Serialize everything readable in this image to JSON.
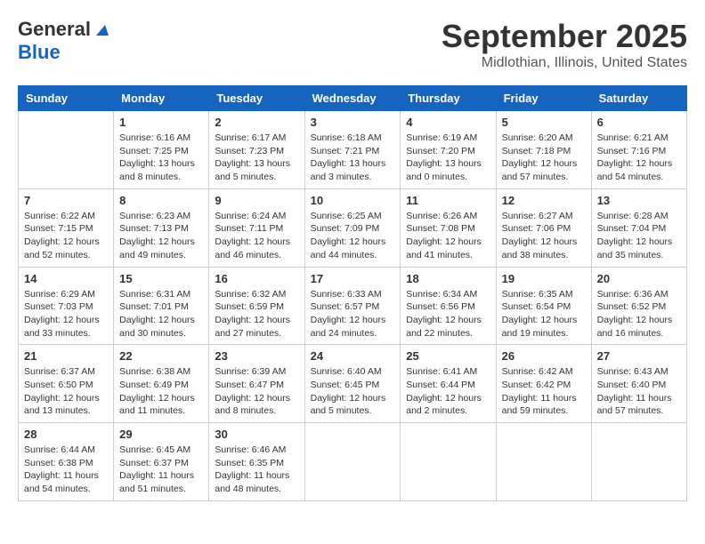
{
  "header": {
    "logo_line1": "General",
    "logo_line2": "Blue",
    "month_title": "September 2025",
    "location": "Midlothian, Illinois, United States"
  },
  "weekdays": [
    "Sunday",
    "Monday",
    "Tuesday",
    "Wednesday",
    "Thursday",
    "Friday",
    "Saturday"
  ],
  "weeks": [
    [
      {
        "day": "",
        "info": ""
      },
      {
        "day": "1",
        "info": "Sunrise: 6:16 AM\nSunset: 7:25 PM\nDaylight: 13 hours\nand 8 minutes."
      },
      {
        "day": "2",
        "info": "Sunrise: 6:17 AM\nSunset: 7:23 PM\nDaylight: 13 hours\nand 5 minutes."
      },
      {
        "day": "3",
        "info": "Sunrise: 6:18 AM\nSunset: 7:21 PM\nDaylight: 13 hours\nand 3 minutes."
      },
      {
        "day": "4",
        "info": "Sunrise: 6:19 AM\nSunset: 7:20 PM\nDaylight: 13 hours\nand 0 minutes."
      },
      {
        "day": "5",
        "info": "Sunrise: 6:20 AM\nSunset: 7:18 PM\nDaylight: 12 hours\nand 57 minutes."
      },
      {
        "day": "6",
        "info": "Sunrise: 6:21 AM\nSunset: 7:16 PM\nDaylight: 12 hours\nand 54 minutes."
      }
    ],
    [
      {
        "day": "7",
        "info": "Sunrise: 6:22 AM\nSunset: 7:15 PM\nDaylight: 12 hours\nand 52 minutes."
      },
      {
        "day": "8",
        "info": "Sunrise: 6:23 AM\nSunset: 7:13 PM\nDaylight: 12 hours\nand 49 minutes."
      },
      {
        "day": "9",
        "info": "Sunrise: 6:24 AM\nSunset: 7:11 PM\nDaylight: 12 hours\nand 46 minutes."
      },
      {
        "day": "10",
        "info": "Sunrise: 6:25 AM\nSunset: 7:09 PM\nDaylight: 12 hours\nand 44 minutes."
      },
      {
        "day": "11",
        "info": "Sunrise: 6:26 AM\nSunset: 7:08 PM\nDaylight: 12 hours\nand 41 minutes."
      },
      {
        "day": "12",
        "info": "Sunrise: 6:27 AM\nSunset: 7:06 PM\nDaylight: 12 hours\nand 38 minutes."
      },
      {
        "day": "13",
        "info": "Sunrise: 6:28 AM\nSunset: 7:04 PM\nDaylight: 12 hours\nand 35 minutes."
      }
    ],
    [
      {
        "day": "14",
        "info": "Sunrise: 6:29 AM\nSunset: 7:03 PM\nDaylight: 12 hours\nand 33 minutes."
      },
      {
        "day": "15",
        "info": "Sunrise: 6:31 AM\nSunset: 7:01 PM\nDaylight: 12 hours\nand 30 minutes."
      },
      {
        "day": "16",
        "info": "Sunrise: 6:32 AM\nSunset: 6:59 PM\nDaylight: 12 hours\nand 27 minutes."
      },
      {
        "day": "17",
        "info": "Sunrise: 6:33 AM\nSunset: 6:57 PM\nDaylight: 12 hours\nand 24 minutes."
      },
      {
        "day": "18",
        "info": "Sunrise: 6:34 AM\nSunset: 6:56 PM\nDaylight: 12 hours\nand 22 minutes."
      },
      {
        "day": "19",
        "info": "Sunrise: 6:35 AM\nSunset: 6:54 PM\nDaylight: 12 hours\nand 19 minutes."
      },
      {
        "day": "20",
        "info": "Sunrise: 6:36 AM\nSunset: 6:52 PM\nDaylight: 12 hours\nand 16 minutes."
      }
    ],
    [
      {
        "day": "21",
        "info": "Sunrise: 6:37 AM\nSunset: 6:50 PM\nDaylight: 12 hours\nand 13 minutes."
      },
      {
        "day": "22",
        "info": "Sunrise: 6:38 AM\nSunset: 6:49 PM\nDaylight: 12 hours\nand 11 minutes."
      },
      {
        "day": "23",
        "info": "Sunrise: 6:39 AM\nSunset: 6:47 PM\nDaylight: 12 hours\nand 8 minutes."
      },
      {
        "day": "24",
        "info": "Sunrise: 6:40 AM\nSunset: 6:45 PM\nDaylight: 12 hours\nand 5 minutes."
      },
      {
        "day": "25",
        "info": "Sunrise: 6:41 AM\nSunset: 6:44 PM\nDaylight: 12 hours\nand 2 minutes."
      },
      {
        "day": "26",
        "info": "Sunrise: 6:42 AM\nSunset: 6:42 PM\nDaylight: 11 hours\nand 59 minutes."
      },
      {
        "day": "27",
        "info": "Sunrise: 6:43 AM\nSunset: 6:40 PM\nDaylight: 11 hours\nand 57 minutes."
      }
    ],
    [
      {
        "day": "28",
        "info": "Sunrise: 6:44 AM\nSunset: 6:38 PM\nDaylight: 11 hours\nand 54 minutes."
      },
      {
        "day": "29",
        "info": "Sunrise: 6:45 AM\nSunset: 6:37 PM\nDaylight: 11 hours\nand 51 minutes."
      },
      {
        "day": "30",
        "info": "Sunrise: 6:46 AM\nSunset: 6:35 PM\nDaylight: 11 hours\nand 48 minutes."
      },
      {
        "day": "",
        "info": ""
      },
      {
        "day": "",
        "info": ""
      },
      {
        "day": "",
        "info": ""
      },
      {
        "day": "",
        "info": ""
      }
    ]
  ]
}
